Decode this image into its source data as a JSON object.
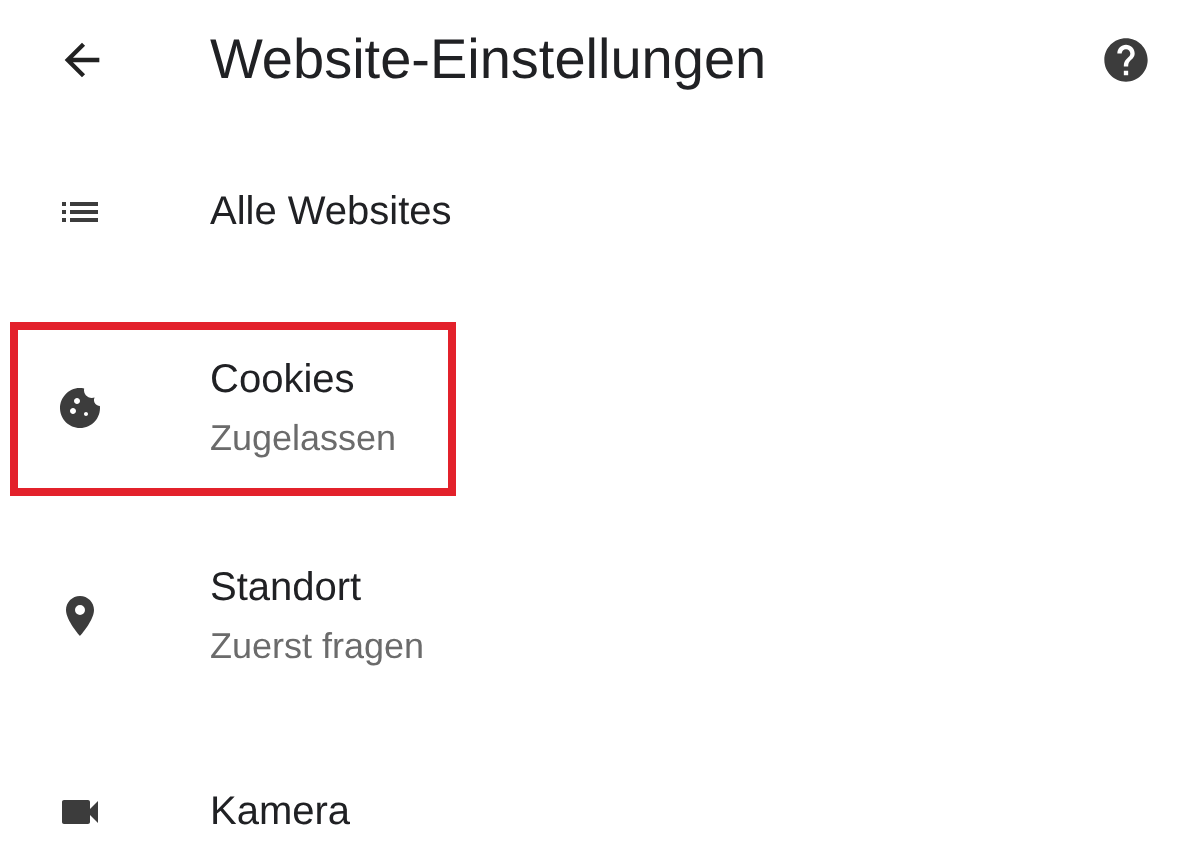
{
  "header": {
    "title": "Website-Einstellungen"
  },
  "items": [
    {
      "kind": "list",
      "title": "Alle Websites",
      "highlighted": false
    },
    {
      "kind": "cookie",
      "title": "Cookies",
      "subtitle": "Zugelassen",
      "highlighted": true
    },
    {
      "kind": "location",
      "title": "Standort",
      "subtitle": "Zuerst fragen",
      "highlighted": false
    },
    {
      "kind": "camera",
      "title": "Kamera",
      "highlighted": false
    }
  ]
}
